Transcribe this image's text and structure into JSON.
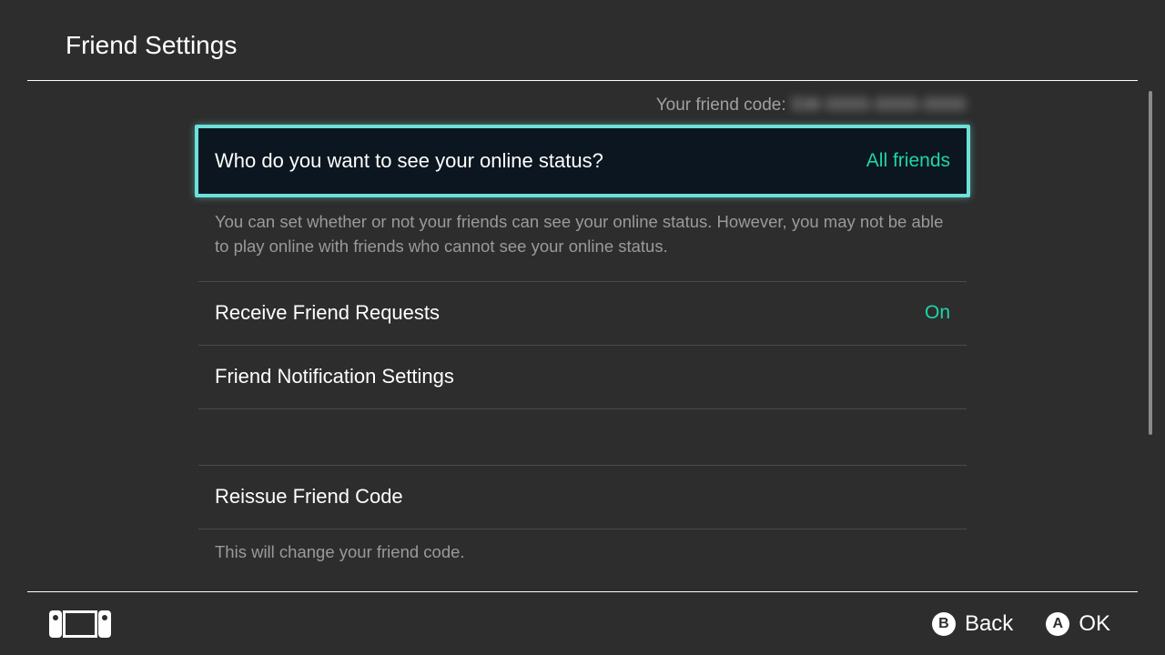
{
  "header": {
    "title": "Friend Settings"
  },
  "friend_code": {
    "label": "Your friend code:",
    "value": "SW-0000-0000-0000"
  },
  "items": {
    "online_status": {
      "label": "Who do you want to see your online status?",
      "value": "All friends",
      "description": "You can set whether or not your friends can see your online status. However, you may not be able to play online with friends who cannot see your online status."
    },
    "receive_requests": {
      "label": "Receive Friend Requests",
      "value": "On"
    },
    "notification": {
      "label": "Friend Notification Settings"
    },
    "reissue": {
      "label": "Reissue Friend Code",
      "description": "This will change your friend code."
    }
  },
  "footer": {
    "back": {
      "glyph": "B",
      "label": "Back"
    },
    "ok": {
      "glyph": "A",
      "label": "OK"
    }
  }
}
